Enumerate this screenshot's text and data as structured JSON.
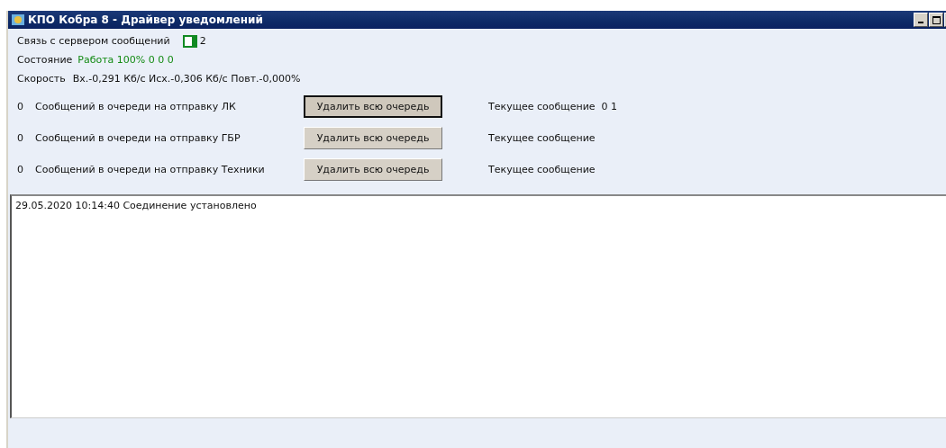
{
  "window": {
    "title": "КПО Кобра 8 - Драйвер уведомлений"
  },
  "connection": {
    "label": "Связь с сервером сообщений",
    "connected": true,
    "count": "2"
  },
  "state": {
    "label": "Состояние",
    "value": "Работа 100% 0 0 0"
  },
  "speed": {
    "label": "Скорость",
    "value": "Вх.-0,291 Кб/с Исх.-0,306 Кб/с Повт.-0,000%"
  },
  "queues": [
    {
      "count": "0",
      "label": "Сообщений в очереди на отправку ЛК",
      "button": "Удалить всю очередь",
      "focused": true,
      "current": "Текущее сообщение  0 1"
    },
    {
      "count": "0",
      "label": "Сообщений в очереди на отправку ГБР",
      "button": "Удалить всю очередь",
      "focused": false,
      "current": "Текущее сообщение"
    },
    {
      "count": "0",
      "label": "Сообщений в очереди на отправку Техники",
      "button": "Удалить всю очередь",
      "focused": false,
      "current": "Текущее сообщение"
    }
  ],
  "log": {
    "lines": [
      "29.05.2020 10:14:40 Соединение установлено"
    ]
  }
}
